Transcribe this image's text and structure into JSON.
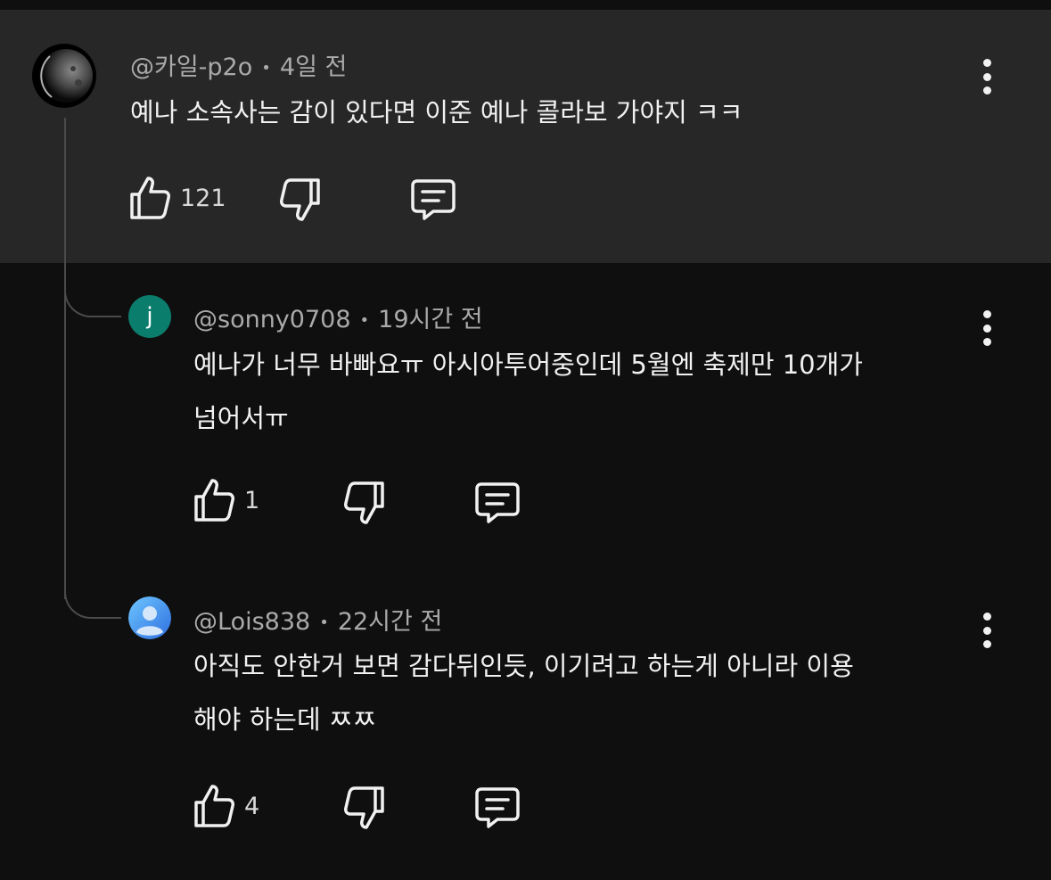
{
  "comments": [
    {
      "author": "@카일-p2o",
      "time": "4일 전",
      "text": "예나 소속사는 감이 있다면 이준 예나 콜라보 가야지 ㅋㅋ",
      "likes": "121",
      "avatar": {
        "type": "moon-photo"
      }
    },
    {
      "author": "@sonny0708",
      "time": "19시간 전",
      "text_lines": [
        "예나가 너무 바빠요ㅠ 아시아투어중인데 5월엔 축제만 10개가",
        "넘어서ㅠ"
      ],
      "likes": "1",
      "avatar": {
        "type": "letter",
        "letter": "j",
        "color": "#0b7d6c"
      }
    },
    {
      "author": "@Lois838",
      "time": "22시간 전",
      "text_lines": [
        "아직도 안한거 보면 감다뒤인듯, 이기려고 하는게 아니라 이용",
        "해야 하는데 ㅉㅉ"
      ],
      "likes": "4",
      "avatar": {
        "type": "default-person",
        "color": "#3ea6ff"
      }
    }
  ],
  "separator": "•",
  "icons": [
    "like-icon",
    "dislike-icon",
    "reply-icon",
    "more-options-icon"
  ]
}
